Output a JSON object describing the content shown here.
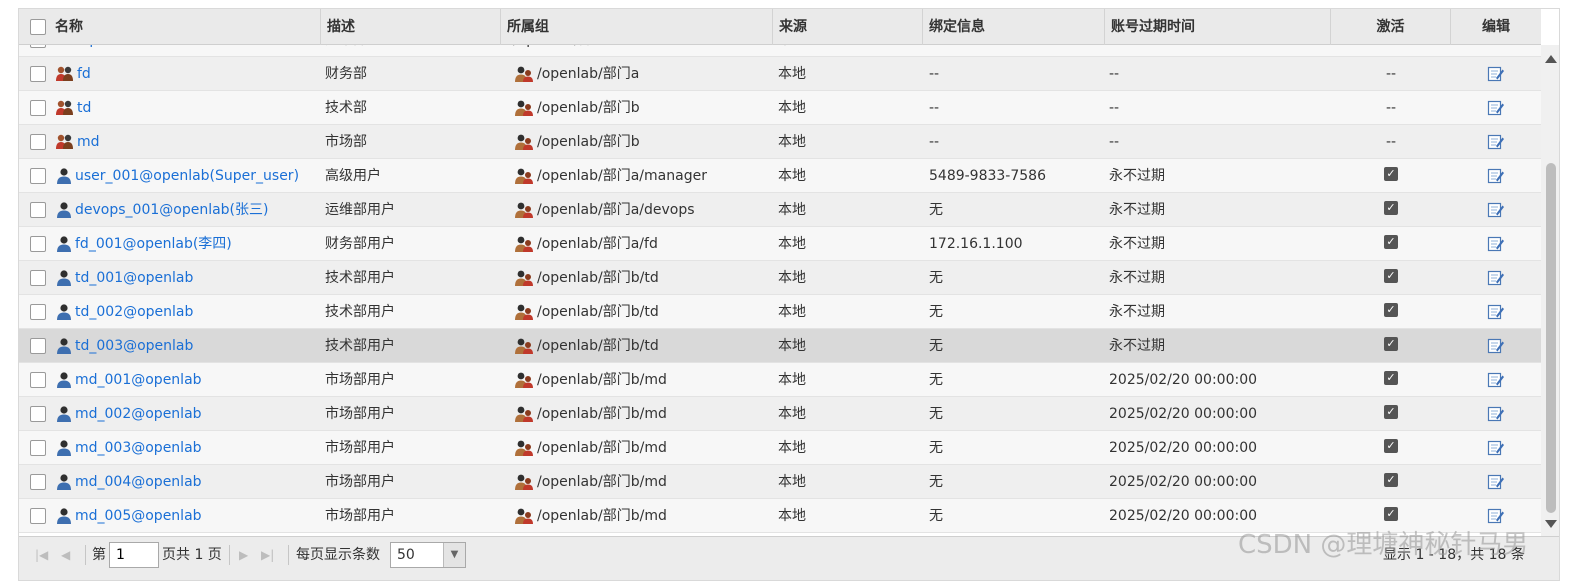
{
  "columns": {
    "name": "名称",
    "desc": "描述",
    "group": "所属组",
    "source": "来源",
    "bind": "绑定信息",
    "expire": "账号过期时间",
    "active": "激活",
    "edit": "编辑"
  },
  "partial_row": {
    "name": "devops",
    "desc": "运维部",
    "group": "/openlab/部门a",
    "source": "本地"
  },
  "rows": [
    {
      "type": "group",
      "name": "fd",
      "desc": "财务部",
      "group": "/openlab/部门a",
      "source": "本地",
      "bind": "--",
      "expire": "--",
      "active": "--"
    },
    {
      "type": "group",
      "name": "td",
      "desc": "技术部",
      "group": "/openlab/部门b",
      "source": "本地",
      "bind": "--",
      "expire": "--",
      "active": "--"
    },
    {
      "type": "group",
      "name": "md",
      "desc": "市场部",
      "group": "/openlab/部门b",
      "source": "本地",
      "bind": "--",
      "expire": "--",
      "active": "--"
    },
    {
      "type": "user",
      "name": "user_001@openlab(Super_user)",
      "desc": "高级用户",
      "group": "/openlab/部门a/manager",
      "source": "本地",
      "bind": "5489-9833-7586",
      "expire": "永不过期",
      "active": "checked"
    },
    {
      "type": "user",
      "name": "devops_001@openlab(张三)",
      "desc": "运维部用户",
      "group": "/openlab/部门a/devops",
      "source": "本地",
      "bind": "无",
      "expire": "永不过期",
      "active": "checked"
    },
    {
      "type": "user",
      "name": "fd_001@openlab(李四)",
      "desc": "财务部用户",
      "group": "/openlab/部门a/fd",
      "source": "本地",
      "bind": "172.16.1.100",
      "expire": "永不过期",
      "active": "checked"
    },
    {
      "type": "user",
      "name": "td_001@openlab",
      "desc": "技术部用户",
      "group": "/openlab/部门b/td",
      "source": "本地",
      "bind": "无",
      "expire": "永不过期",
      "active": "checked"
    },
    {
      "type": "user",
      "name": "td_002@openlab",
      "desc": "技术部用户",
      "group": "/openlab/部门b/td",
      "source": "本地",
      "bind": "无",
      "expire": "永不过期",
      "active": "checked"
    },
    {
      "type": "user",
      "name": "td_003@openlab",
      "desc": "技术部用户",
      "group": "/openlab/部门b/td",
      "source": "本地",
      "bind": "无",
      "expire": "永不过期",
      "active": "checked",
      "selected": true
    },
    {
      "type": "user",
      "name": "md_001@openlab",
      "desc": "市场部用户",
      "group": "/openlab/部门b/md",
      "source": "本地",
      "bind": "无",
      "expire": "2025/02/20 00:00:00",
      "active": "checked"
    },
    {
      "type": "user",
      "name": "md_002@openlab",
      "desc": "市场部用户",
      "group": "/openlab/部门b/md",
      "source": "本地",
      "bind": "无",
      "expire": "2025/02/20 00:00:00",
      "active": "checked"
    },
    {
      "type": "user",
      "name": "md_003@openlab",
      "desc": "市场部用户",
      "group": "/openlab/部门b/md",
      "source": "本地",
      "bind": "无",
      "expire": "2025/02/20 00:00:00",
      "active": "checked"
    },
    {
      "type": "user",
      "name": "md_004@openlab",
      "desc": "市场部用户",
      "group": "/openlab/部门b/md",
      "source": "本地",
      "bind": "无",
      "expire": "2025/02/20 00:00:00",
      "active": "checked"
    },
    {
      "type": "user",
      "name": "md_005@openlab",
      "desc": "市场部用户",
      "group": "/openlab/部门b/md",
      "source": "本地",
      "bind": "无",
      "expire": "2025/02/20 00:00:00",
      "active": "checked"
    }
  ],
  "pager": {
    "page_prefix": "第",
    "page_value": "1",
    "page_suffix": "页共 1 页",
    "per_page_label": "每页显示条数",
    "per_page_value": "50",
    "summary": "显示 1 - 18，共 18 条"
  },
  "watermark": "CSDN @理塘神秘针马男",
  "icons": {
    "group_icon": "user-group-icon",
    "user_icon": "user-icon",
    "org_icon": "org-group-icon",
    "edit_icon": "edit-icon"
  },
  "colors": {
    "link": "#1a6fd6",
    "header_bg": "#eaeaea",
    "selected_row": "#d9d9d9"
  }
}
